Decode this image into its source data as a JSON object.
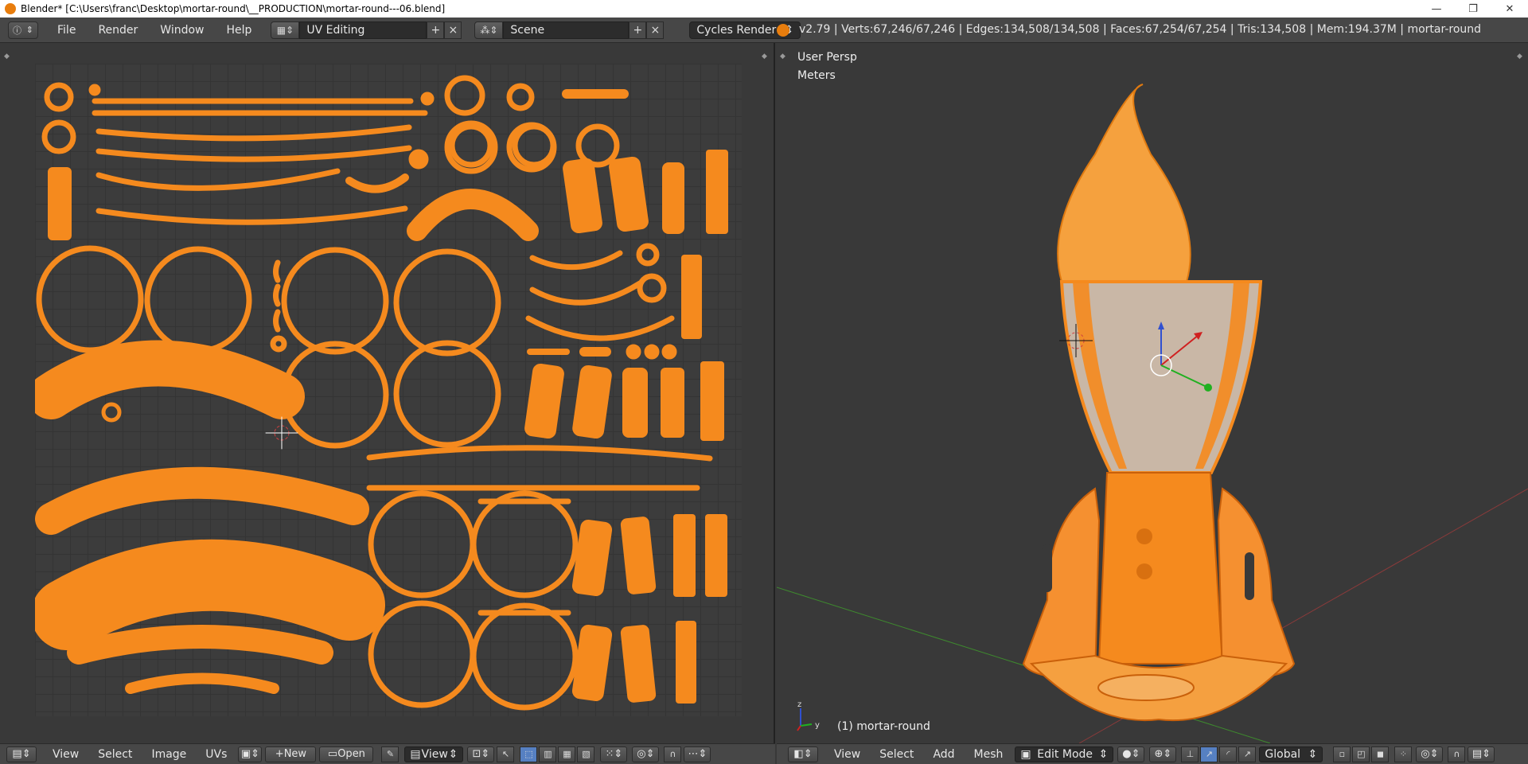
{
  "window": {
    "title": "Blender* [C:\\Users\\franc\\Desktop\\mortar-round\\__PRODUCTION\\mortar-round---06.blend]",
    "minimize": "—",
    "restore": "❐",
    "close": "✕"
  },
  "info_header": {
    "menus": [
      "File",
      "Render",
      "Window",
      "Help"
    ],
    "screen_layout": "UV Editing",
    "scene": "Scene",
    "render_engine": "Cycles Render",
    "stats": "v2.79 | Verts:67,246/67,246 | Edges:134,508/134,508 | Faces:67,254/67,254 | Tris:134,508 | Mem:194.37M | mortar-round"
  },
  "viewport": {
    "view_name": "User Persp",
    "units": "Meters",
    "object_label": "(1) mortar-round"
  },
  "uv_header": {
    "menus": [
      "View",
      "Select",
      "Image",
      "UVs"
    ],
    "new_label": "New",
    "open_label": "Open",
    "view_label": "View"
  },
  "view3d_header": {
    "menus": [
      "View",
      "Select",
      "Add",
      "Mesh"
    ],
    "mode": "Edit Mode",
    "orientation": "Global"
  },
  "colors": {
    "mesh_orange": "#f58a1e",
    "background": "#393939"
  }
}
